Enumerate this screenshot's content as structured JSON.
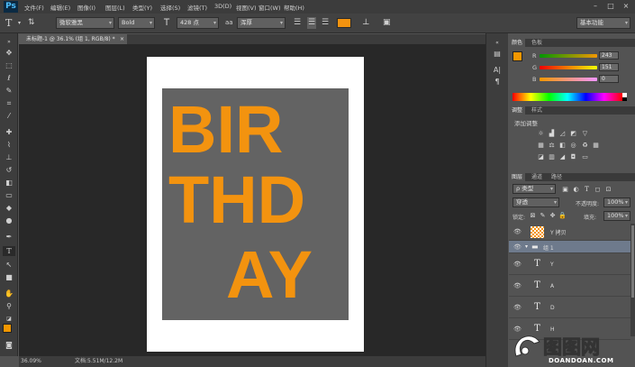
{
  "app": {
    "logo": "Ps"
  },
  "menu": [
    "文件(F)",
    "编辑(E)",
    "图像(I)",
    "图层(L)",
    "类型(Y)",
    "选择(S)",
    "滤镜(T)",
    "3D(D)",
    "视图(V)",
    "窗口(W)",
    "帮助(H)"
  ],
  "window_controls": [
    "–",
    "□",
    "×"
  ],
  "options": {
    "font_family": "微软雅黑",
    "font_style": "Bold",
    "font_size": "428 点",
    "aa_label": "aa",
    "aa_mode": "浑厚",
    "color_hex": "#f3930f",
    "workspace": "基本功能"
  },
  "document": {
    "tab_title": "未标题-1 @ 36.1% (组 1, RGB/8) *",
    "letters": {
      "row1": "BIR",
      "row2": "THD",
      "row3": "AY"
    },
    "text_color": "#f3930f",
    "zoom": "36.09%",
    "doc_info": "文档:5.51M/12.2M"
  },
  "color_panel": {
    "tabs": [
      "颜色",
      "色板"
    ],
    "channels": [
      {
        "label": "R",
        "value": "243"
      },
      {
        "label": "G",
        "value": "151"
      },
      {
        "label": "B",
        "value": "0"
      }
    ],
    "foreground": "#f39700"
  },
  "adjust_panel": {
    "tabs": [
      "调整",
      "样式"
    ],
    "title": "添加调整"
  },
  "layers_panel": {
    "tabs": [
      "图层",
      "通道",
      "路径"
    ],
    "filter_kind": "ρ 类型",
    "blend_mode": "穿透",
    "opacity_label": "不透明度:",
    "opacity": "100%",
    "lock_label": "锁定:",
    "fill_label": "填充:",
    "fill": "100%",
    "layers": [
      {
        "name": "Y 拷贝",
        "kind": "raster"
      },
      {
        "name": "组 1",
        "kind": "group"
      },
      {
        "name": "Y",
        "kind": "text"
      },
      {
        "name": "A",
        "kind": "text"
      },
      {
        "name": "D",
        "kind": "text"
      },
      {
        "name": "H",
        "kind": "text"
      }
    ]
  },
  "watermark": {
    "brand": "图图网",
    "domain": "DOANDOAN.COM"
  }
}
